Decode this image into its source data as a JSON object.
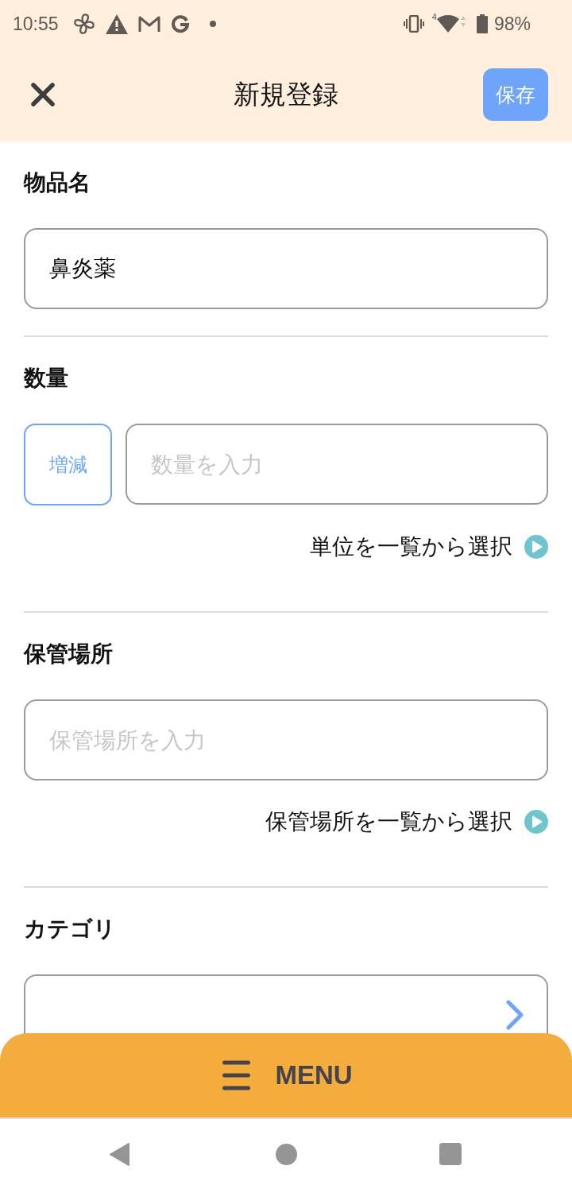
{
  "status_bar": {
    "time": "10:55",
    "network_type": "4",
    "battery": "98%"
  },
  "app_bar": {
    "title": "新規登録",
    "save_button": "保存"
  },
  "sections": [
    {
      "kind": "text",
      "label": "物品名",
      "field": {
        "value": "鼻炎薬"
      }
    },
    {
      "kind": "quantity",
      "label": "数量",
      "button": "増減",
      "field": {
        "placeholder": "数量を入力"
      },
      "link": "単位を一覧から選択"
    },
    {
      "kind": "text",
      "label": "保管場所",
      "field": {
        "placeholder": "保管場所を入力"
      },
      "link": "保管場所を一覧から選択"
    },
    {
      "kind": "select",
      "label": "カテゴリ"
    }
  ],
  "menu_bar": {
    "label": "MENU"
  }
}
